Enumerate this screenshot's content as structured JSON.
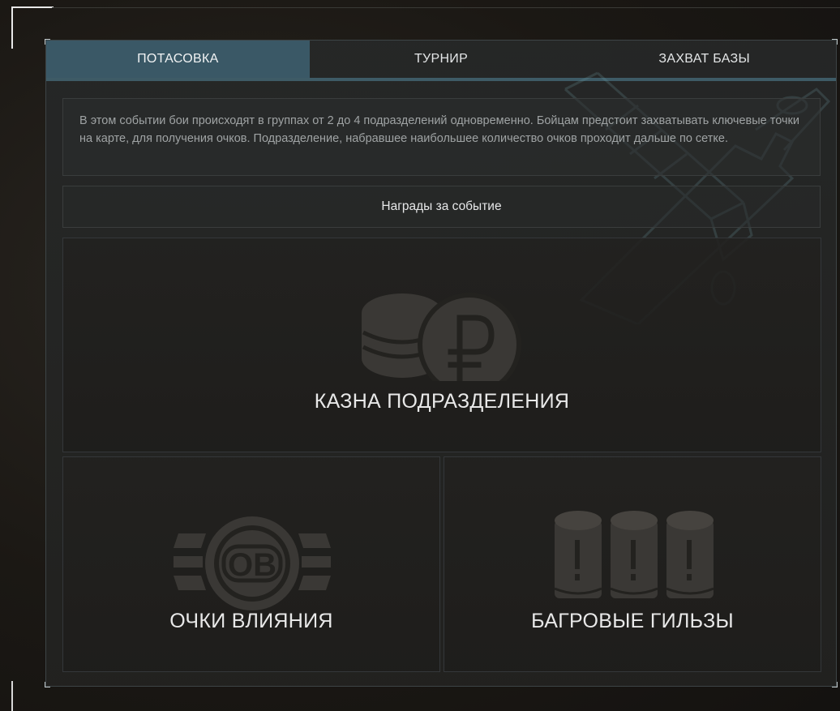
{
  "tabs": [
    {
      "label": "ПОТАСОВКА",
      "active": true
    },
    {
      "label": "ТУРНИР",
      "active": false
    },
    {
      "label": "ЗАХВАТ БАЗЫ",
      "active": false
    }
  ],
  "description": "В этом событии бои происходят в группах от 2 до 4 подразделений одновременно. Бойцам предстоит захватывать ключевые точки на карте, для получения очков. Подразделение, набравшее наибольшее количество очков проходит дальше по сетке.",
  "rewards_title": "Награды за событие",
  "rewards": {
    "treasury": {
      "label": "КАЗНА ПОДРАЗДЕЛЕНИЯ",
      "icon": "ruble-coins-icon"
    },
    "influence": {
      "label": "ОЧКИ ВЛИЯНИЯ",
      "icon": "influence-points-icon",
      "icon_text": "OB"
    },
    "casings": {
      "label": "БАГРОВЫЕ ГИЛЬЗЫ",
      "icon": "shell-casings-icon"
    }
  },
  "colors": {
    "active_tab": "#3a5866",
    "tab_underline": "#3e5b66",
    "text": "#e8e8e8",
    "description_text": "#9fa3a4",
    "icon": "#3a3835"
  }
}
